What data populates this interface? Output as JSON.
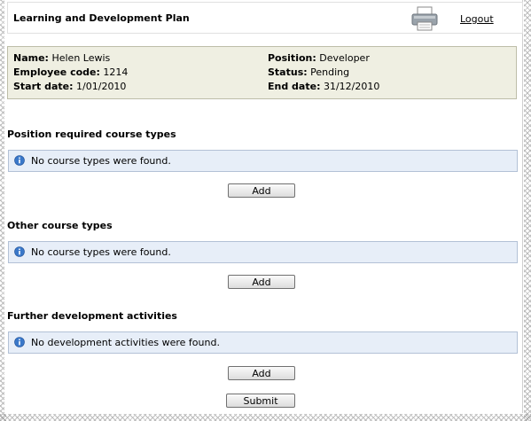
{
  "header": {
    "title": "Learning and Development Plan",
    "print_icon": "printer-icon",
    "logout_label": "Logout"
  },
  "employee": {
    "name_label": "Name:",
    "name": "Helen Lewis",
    "code_label": "Employee code:",
    "code": "1214",
    "start_label": "Start date:",
    "start": "1/01/2010",
    "position_label": "Position:",
    "position": "Developer",
    "status_label": "Status:",
    "status": "Pending",
    "end_label": "End date:",
    "end": "31/12/2010"
  },
  "sections": [
    {
      "title": "Position required course types",
      "message": "No course types were found.",
      "button": "Add"
    },
    {
      "title": "Other course types",
      "message": "No course types were found.",
      "button": "Add"
    },
    {
      "title": "Further development activities",
      "message": "No development activities were found.",
      "button": "Add"
    }
  ],
  "submit_label": "Submit",
  "colors": {
    "info_bg": "#efefe2",
    "message_bg": "#e7eef8",
    "info_icon": "#3a78c9"
  }
}
